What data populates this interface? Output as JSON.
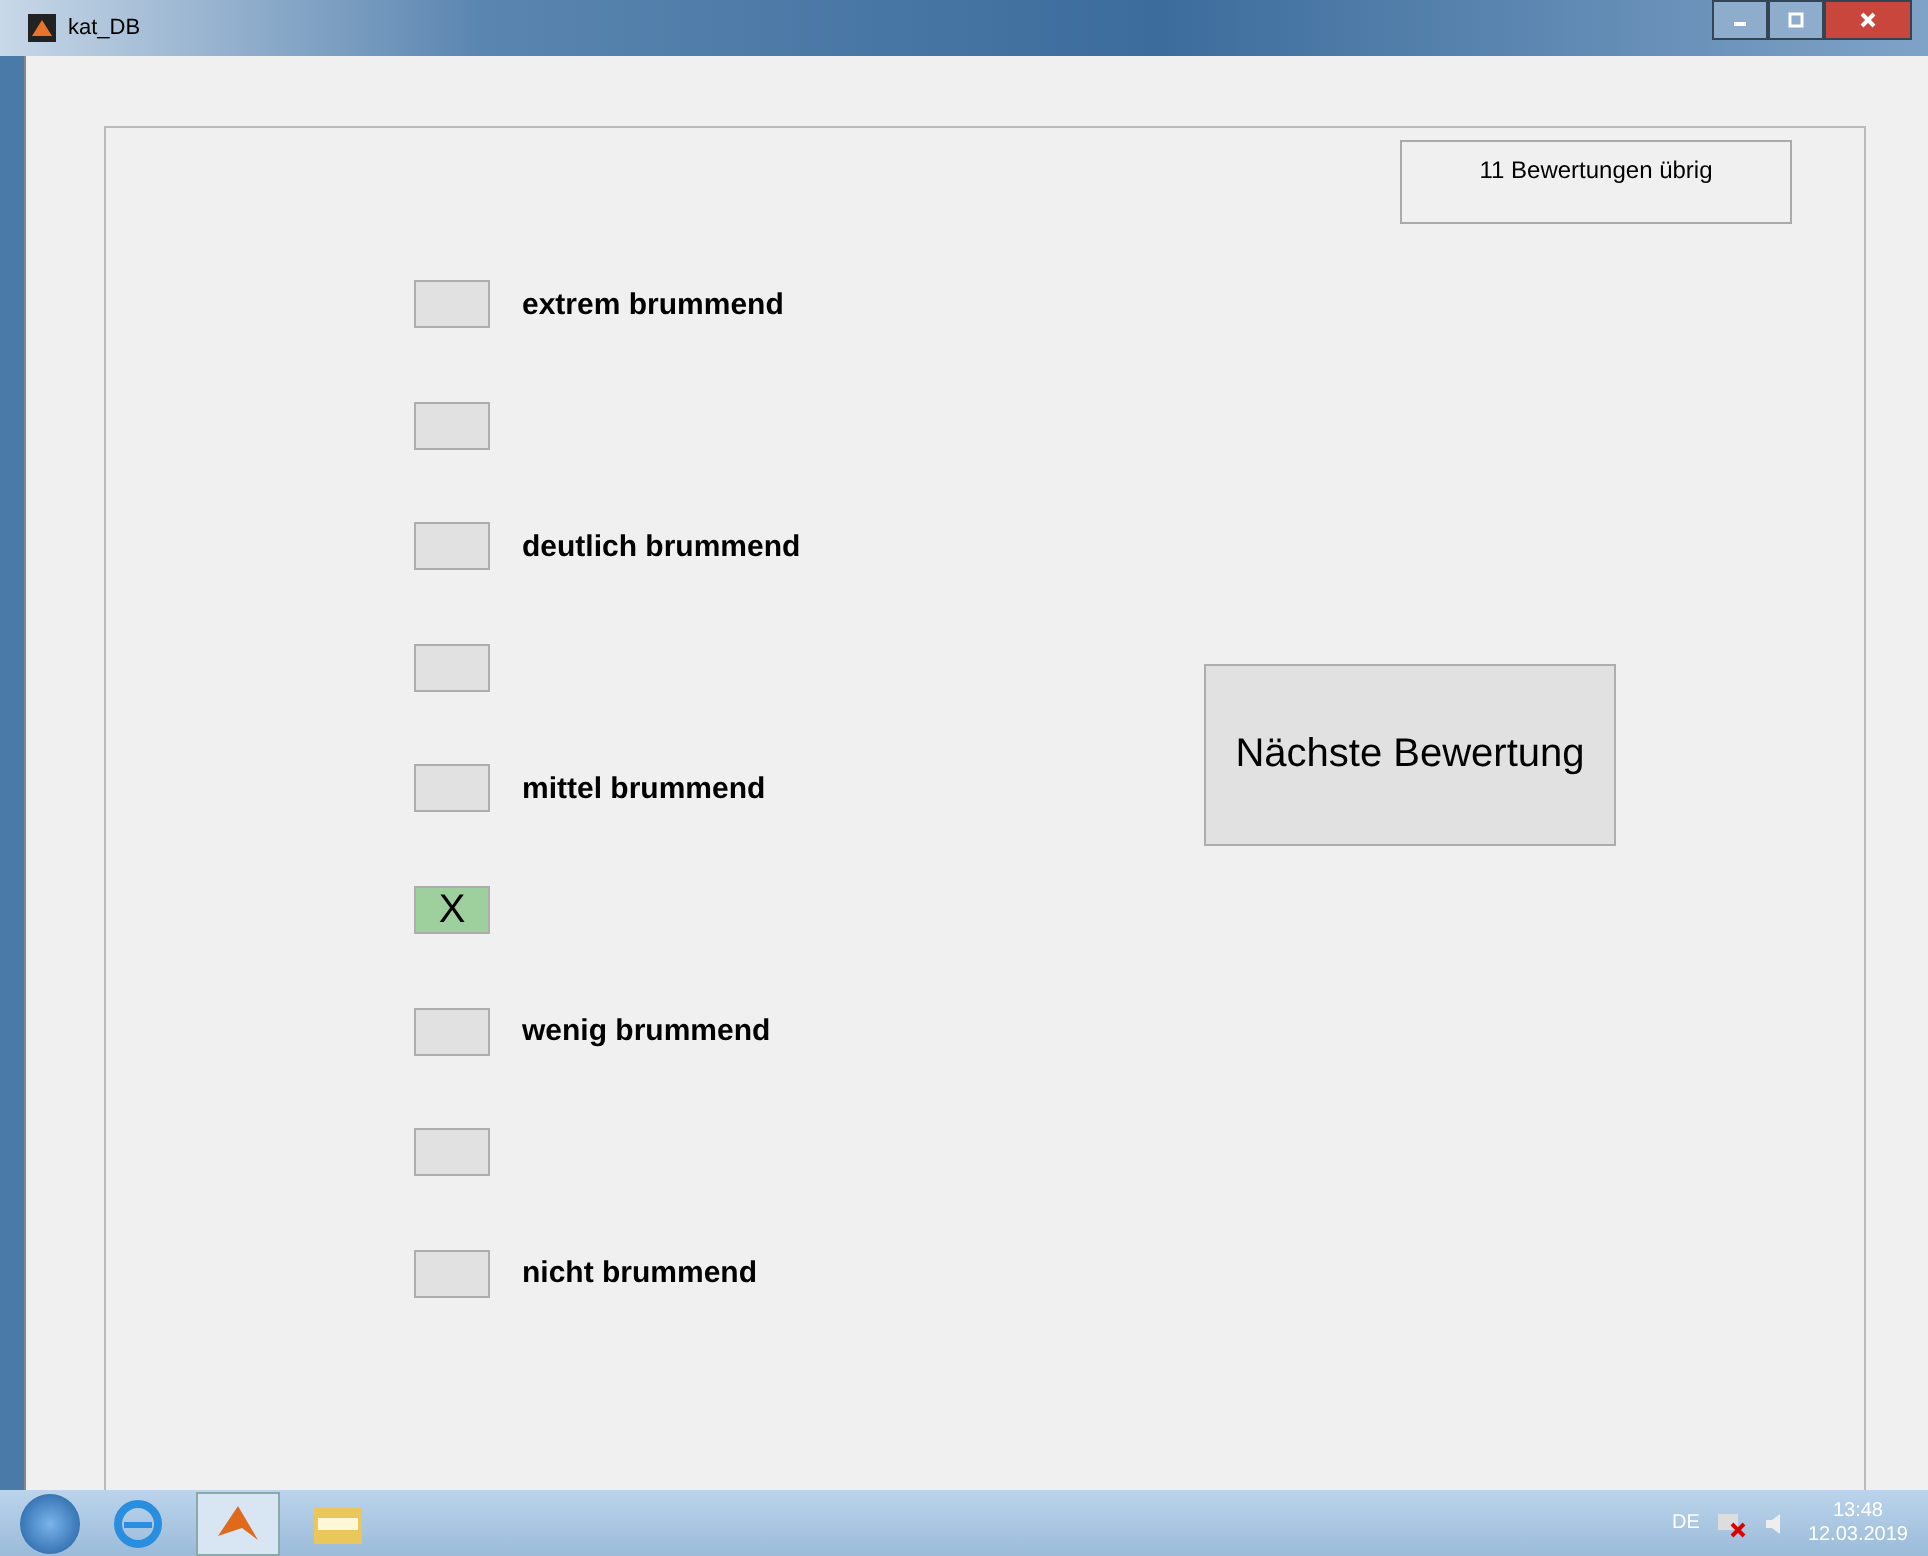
{
  "window": {
    "title": "kat_DB"
  },
  "counter": "11 Bewertungen übrig",
  "selection_mark": "X",
  "options": [
    {
      "label": "extrem brummend",
      "selected": false
    },
    {
      "selected": false
    },
    {
      "label": "deutlich brummend",
      "selected": false
    },
    {
      "selected": false
    },
    {
      "label": "mittel brummend",
      "selected": false
    },
    {
      "selected": true
    },
    {
      "label": "wenig brummend",
      "selected": false
    },
    {
      "selected": false
    },
    {
      "label": "nicht brummend",
      "selected": false
    }
  ],
  "next_button": "Nächste Bewertung",
  "taskbar": {
    "language": "DE",
    "time": "13:48",
    "date": "12.03.2019"
  }
}
